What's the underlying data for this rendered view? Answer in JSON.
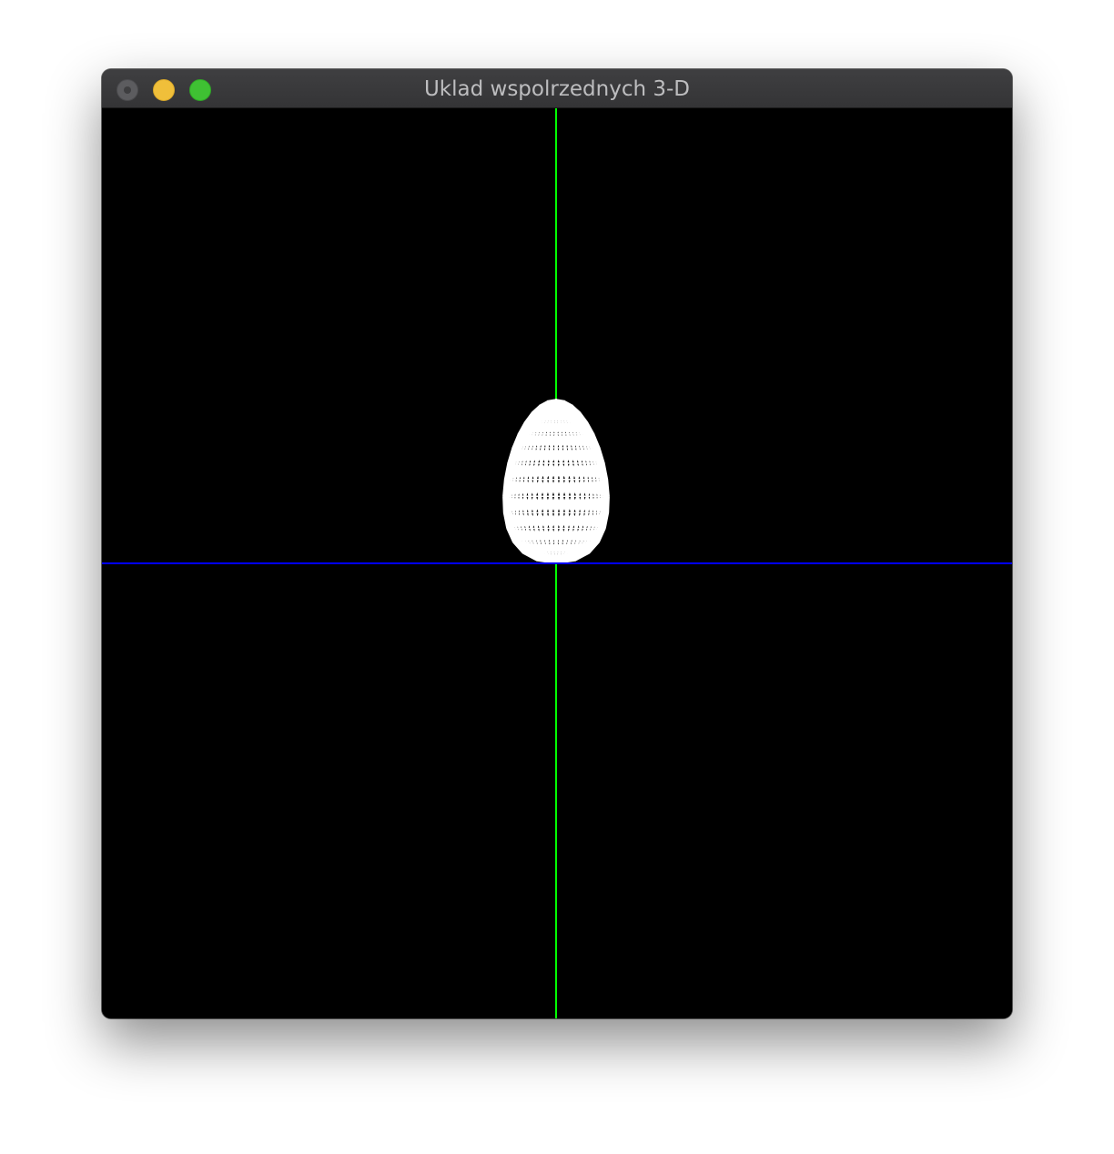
{
  "window": {
    "title": "Uklad wspolrzednych 3-D",
    "buttons": [
      "close",
      "minimize",
      "maximize"
    ]
  },
  "scene": {
    "background": "#000000",
    "axes": [
      {
        "name": "x-axis",
        "color": "#0000ff"
      },
      {
        "name": "y-axis",
        "color": "#00ff00"
      }
    ],
    "model": {
      "name": "egg",
      "render_mode": "wireframe",
      "color": "#ffffff"
    }
  }
}
